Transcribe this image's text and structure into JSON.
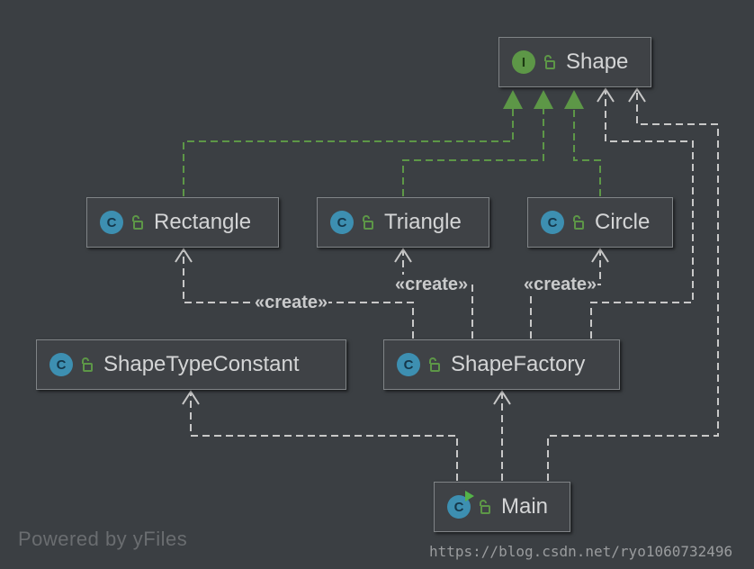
{
  "nodes": {
    "shape": {
      "kind": "interface",
      "badge": "I",
      "name": "Shape"
    },
    "rectangle": {
      "kind": "class",
      "badge": "C",
      "name": "Rectangle"
    },
    "triangle": {
      "kind": "class",
      "badge": "C",
      "name": "Triangle"
    },
    "circle": {
      "kind": "class",
      "badge": "C",
      "name": "Circle"
    },
    "shape_type_constant": {
      "kind": "class",
      "badge": "C",
      "name": "ShapeTypeConstant"
    },
    "shape_factory": {
      "kind": "class",
      "badge": "C",
      "name": "ShapeFactory"
    },
    "main": {
      "kind": "runnable-class",
      "badge": "C",
      "name": "Main"
    }
  },
  "relations": [
    {
      "from": "Rectangle",
      "to": "Shape",
      "type": "implements"
    },
    {
      "from": "Triangle",
      "to": "Shape",
      "type": "implements"
    },
    {
      "from": "Circle",
      "to": "Shape",
      "type": "implements"
    },
    {
      "from": "ShapeFactory",
      "to": "Rectangle",
      "type": "create",
      "label": "«create»"
    },
    {
      "from": "ShapeFactory",
      "to": "Triangle",
      "type": "create",
      "label": "«create»"
    },
    {
      "from": "ShapeFactory",
      "to": "Circle",
      "type": "create",
      "label": "«create»"
    },
    {
      "from": "ShapeFactory",
      "to": "Shape",
      "type": "dependency"
    },
    {
      "from": "Main",
      "to": "ShapeTypeConstant",
      "type": "dependency"
    },
    {
      "from": "Main",
      "to": "ShapeFactory",
      "type": "dependency"
    },
    {
      "from": "Main",
      "to": "Shape",
      "type": "dependency"
    }
  ],
  "labels": {
    "create_rectangle": "«create»",
    "create_triangle": "«create»",
    "create_circle": "«create»"
  },
  "colors": {
    "background": "#3b3f43",
    "node_fill": "#3f4246",
    "node_border": "#808487",
    "implements_line": "#5d9747",
    "dependency_line": "#c8c8c8",
    "class_badge": "#3d8fb1",
    "interface_badge": "#5d9747"
  },
  "footer": {
    "powered_by": "Powered by yFiles",
    "watermark": "https://blog.csdn.net/ryo1060732496"
  }
}
